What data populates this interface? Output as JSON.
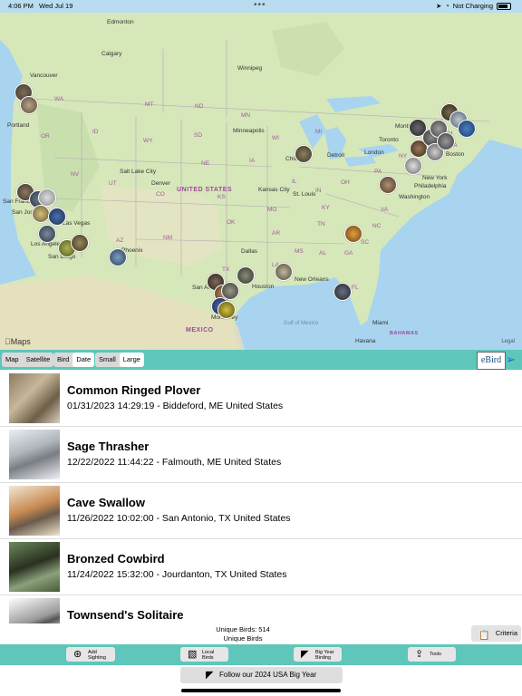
{
  "status_bar": {
    "time": "4:06 PM",
    "date": "Wed Jul 19",
    "more": "•••",
    "battery": "Not Charging"
  },
  "map": {
    "cities": [
      "Edmonton",
      "Calgary",
      "Vancouver",
      "Winnipeg",
      "Portland",
      "Minneapolis",
      "Montréal",
      "Toronto",
      "Chicago",
      "Detroit",
      "London",
      "Boston",
      "Salt Lake City",
      "Denver",
      "Kansas City",
      "St. Louis",
      "New York",
      "Philadelphia",
      "Washington",
      "San Francisco",
      "San Jose",
      "Las Vegas",
      "Los Angeles",
      "San Diego",
      "Phoenix",
      "Dallas",
      "New Orleans",
      "Houston",
      "San Antonio",
      "Monterrey",
      "Miami",
      "Havana"
    ],
    "country": "UNITED STATES",
    "country2": "MEXICO",
    "country3": "BAHAMAS",
    "gulf": "Gulf of Mexico",
    "logo": "Maps",
    "legal": "Legal",
    "state_labels": [
      "WA",
      "OR",
      "ID",
      "MT",
      "ND",
      "MN",
      "WI",
      "MI",
      "NY",
      "ME",
      "VT",
      "NH",
      "MA",
      "PA",
      "OH",
      "IN",
      "IL",
      "IA",
      "NE",
      "SD",
      "WY",
      "NV",
      "UT",
      "CO",
      "KS",
      "MO",
      "KY",
      "VA",
      "NC",
      "TN",
      "AR",
      "OK",
      "TX",
      "LA",
      "MS",
      "AL",
      "GA",
      "SC",
      "FL",
      "NM",
      "AZ"
    ]
  },
  "toolbar": {
    "map_type": [
      {
        "label": "Map",
        "selected": false
      },
      {
        "label": "Satellite",
        "selected": false
      }
    ],
    "sort": [
      {
        "label": "Bird",
        "selected": false
      },
      {
        "label": "Date",
        "selected": true
      }
    ],
    "size": [
      {
        "label": "Small",
        "selected": false
      },
      {
        "label": "Large",
        "selected": true
      }
    ],
    "logo": "eBird",
    "location_icon": "location-arrow-icon"
  },
  "sightings": [
    {
      "name": "Common Ringed Plover",
      "detail": "01/31/2023 14:29:19 - Biddeford, ME  United States"
    },
    {
      "name": "Sage Thrasher",
      "detail": "12/22/2022 11:44:22 - Falmouth, ME  United States"
    },
    {
      "name": "Cave Swallow",
      "detail": "11/26/2022 10:02:00 - San Antonio, TX  United States"
    },
    {
      "name": "Bronzed Cowbird",
      "detail": "11/24/2022 15:32:00 - Jourdanton, TX  United States"
    },
    {
      "name": "Townsend's Solitaire",
      "detail": ""
    }
  ],
  "counts": {
    "unique": "Unique Birds: 514",
    "subtitle": "Unique Birds"
  },
  "criteria_label": "Criteria",
  "nav": {
    "add": {
      "line1": "Add",
      "line2": "Sighting"
    },
    "local": {
      "line1": "Local",
      "line2": "Birds"
    },
    "bigyear": {
      "line1": "Big Year",
      "line2": "Birding"
    },
    "tools": "Tools"
  },
  "follow_label": "Follow our 2024 USA Big Year",
  "colors": {
    "teal": "#5ec6ba",
    "map_water": "#a8d4ef",
    "land": "#d6e7b9"
  }
}
